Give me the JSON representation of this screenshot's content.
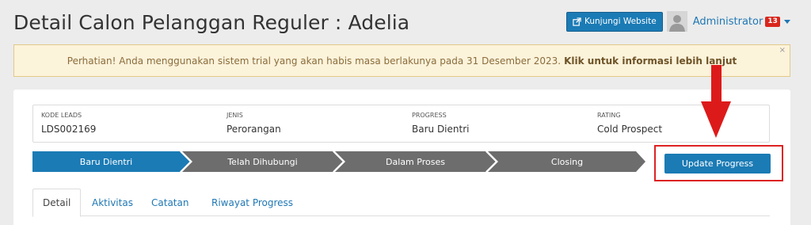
{
  "page": {
    "title": "Detail Calon Pelanggan Reguler : Adelia"
  },
  "topbar": {
    "visit_label": "Kunjungi Website",
    "user_name": "Administrator",
    "notif_count": "13"
  },
  "alert": {
    "message": "Perhatian! Anda menggunakan sistem trial yang akan habis masa berlakunya pada 31 Desember 2023.",
    "link": "Klik untuk informasi lebih lanjut",
    "close": "×"
  },
  "info": [
    {
      "label": "KODE LEADS",
      "value": "LDS002169"
    },
    {
      "label": "JENIS",
      "value": "Perorangan"
    },
    {
      "label": "PROGRESS",
      "value": "Baru Dientri"
    },
    {
      "label": "RATING",
      "value": "Cold Prospect"
    }
  ],
  "steps": [
    {
      "label": "Baru Dientri",
      "active": true
    },
    {
      "label": "Telah Dihubungi",
      "active": false
    },
    {
      "label": "Dalam Proses",
      "active": false
    },
    {
      "label": "Closing",
      "active": false
    }
  ],
  "update_button": "Update Progress",
  "tabs": [
    "Detail",
    "Aktivitas",
    "Catatan",
    "Riwayat Progress"
  ],
  "colors": {
    "primary": "#1b7bb5",
    "step_inactive": "#6d6d6d",
    "annotation": "#dd2222"
  }
}
